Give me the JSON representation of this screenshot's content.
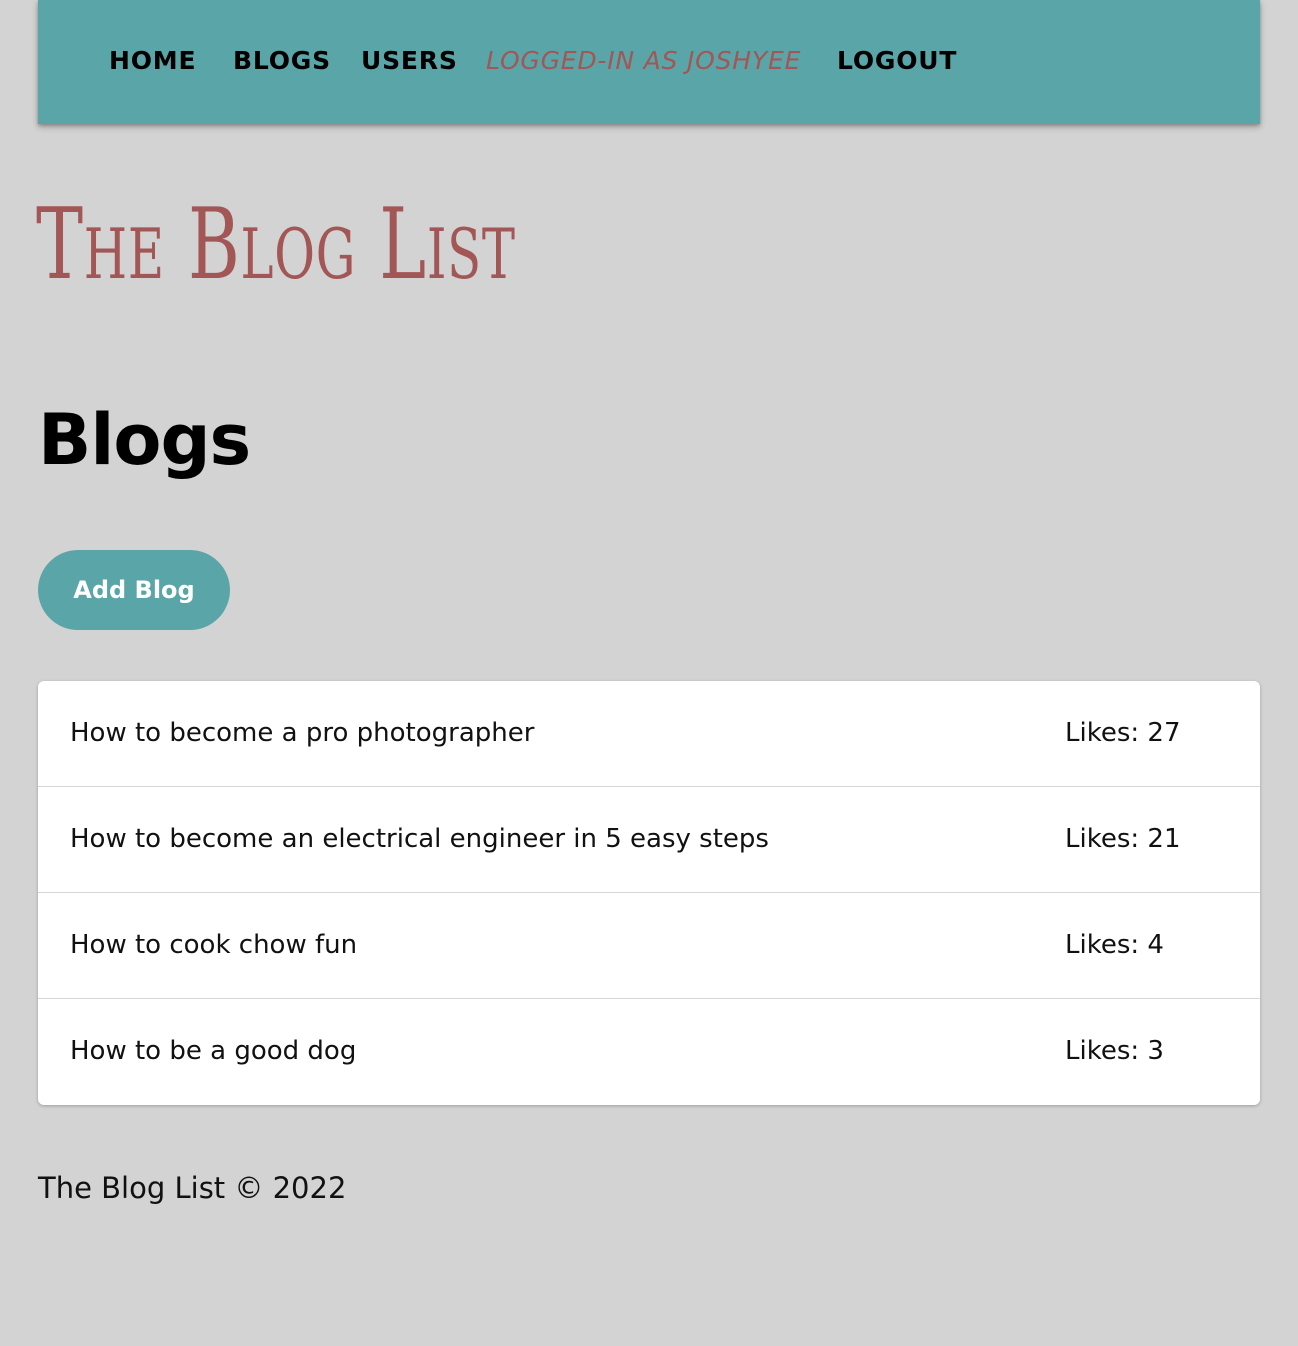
{
  "nav": {
    "home": "Home",
    "blogs": "Blogs",
    "users": "Users",
    "logged_in": "Logged-in as joshyee",
    "logout": "Logout"
  },
  "site_title": "The Blog List",
  "page_title": "Blogs",
  "add_blog_label": "Add Blog",
  "blogs": [
    {
      "title": "How to become a pro photographer",
      "likes": "Likes: 27"
    },
    {
      "title": "How to become an electrical engineer in 5 easy steps",
      "likes": "Likes: 21"
    },
    {
      "title": "How to cook chow fun",
      "likes": "Likes: 4"
    },
    {
      "title": "How to be a good dog",
      "likes": "Likes: 3"
    }
  ],
  "footer": "The Blog List © 2022",
  "colors": {
    "navbar": "#5aa5a8",
    "accent": "#a35656",
    "background": "#d3d3d3"
  }
}
